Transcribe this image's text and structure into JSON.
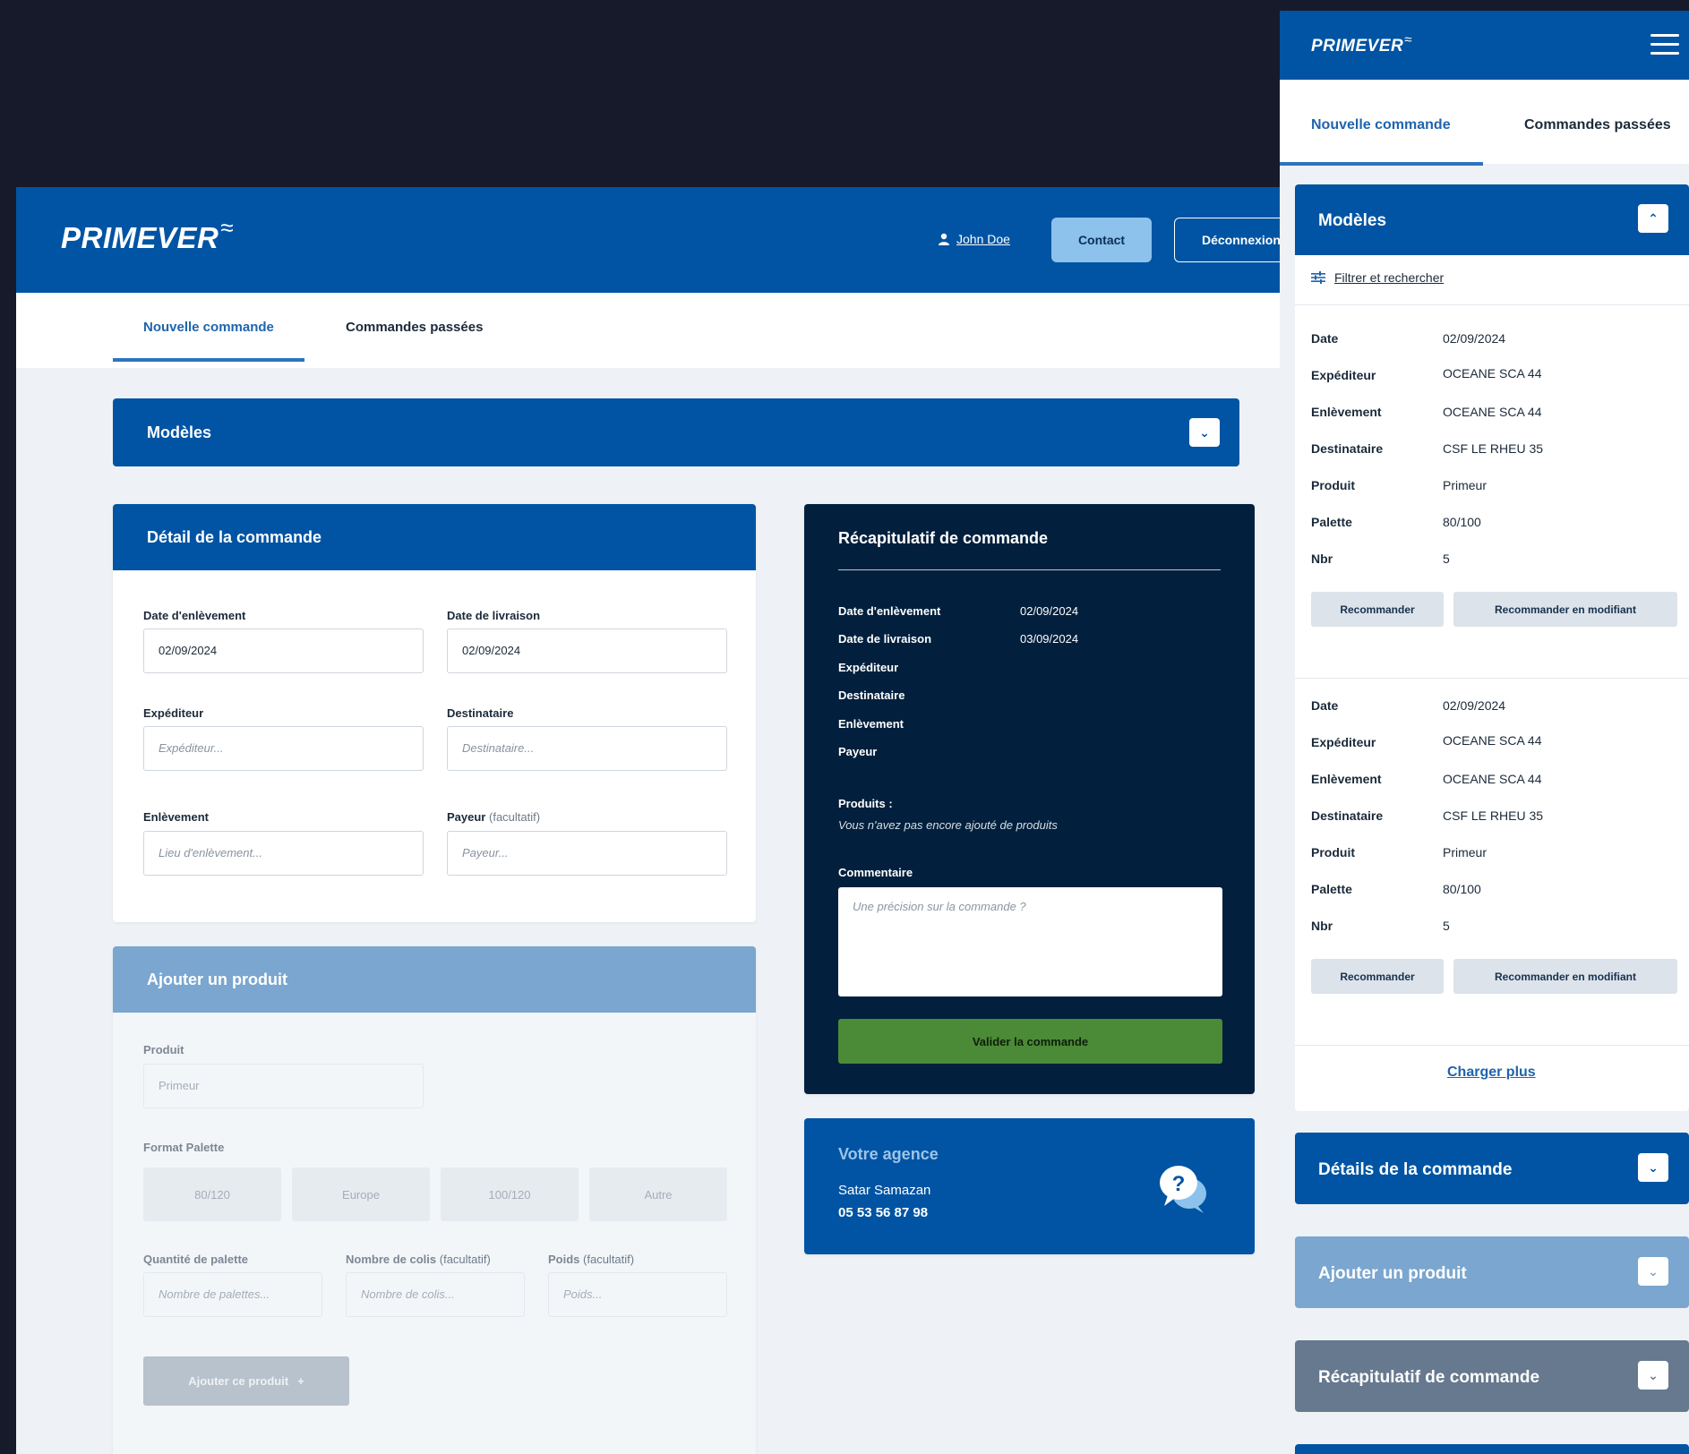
{
  "colors": {
    "brand": "#0054a3",
    "recap_bg": "#02203d",
    "validate": "#4b8a37",
    "light_blue": "#7aa6cf"
  },
  "brand": {
    "name": "PRIMEVER",
    "mark": "≈"
  },
  "header": {
    "user": "John Doe",
    "contact_label": "Contact",
    "logout_label": "Déconnexion"
  },
  "tabs": {
    "new_order": "Nouvelle commande",
    "past_orders": "Commandes passées"
  },
  "models_bar": {
    "title": "Modèles"
  },
  "detail": {
    "title": "Détail de la commande",
    "pickup_date_label": "Date d'enlèvement",
    "pickup_date_value": "02/09/2024",
    "delivery_date_label": "Date de livraison",
    "delivery_date_value": "02/09/2024",
    "sender_label": "Expéditeur",
    "sender_placeholder": "Expéditeur...",
    "recipient_label": "Destinataire",
    "recipient_placeholder": "Destinataire...",
    "pickup_label": "Enlèvement",
    "pickup_placeholder": "Lieu d'enlèvement...",
    "payer_label": "Payeur",
    "payer_optional": "(facultatif)",
    "payer_placeholder": "Payeur..."
  },
  "add_product": {
    "title": "Ajouter un produit",
    "product_label": "Produit",
    "product_value": "Primeur",
    "pallet_format_label": "Format Palette",
    "pallet_formats": [
      "80/120",
      "Europe",
      "100/120",
      "Autre"
    ],
    "pallet_qty_label": "Quantité de palette",
    "pallet_qty_placeholder": "Nombre de palettes...",
    "parcels_label": "Nombre de colis",
    "parcels_optional": "(facultatif)",
    "parcels_placeholder": "Nombre de colis...",
    "weight_label": "Poids",
    "weight_optional": "(facultatif)",
    "weight_placeholder": "Poids...",
    "add_button": "Ajouter ce produit",
    "add_button_icon": "+"
  },
  "recap": {
    "title": "Récapitulatif de commande",
    "rows": [
      {
        "label": "Date d'enlèvement",
        "value": "02/09/2024"
      },
      {
        "label": "Date de livraison",
        "value": "03/09/2024"
      },
      {
        "label": "Expéditeur",
        "value": ""
      },
      {
        "label": "Destinataire",
        "value": ""
      },
      {
        "label": "Enlèvement",
        "value": ""
      },
      {
        "label": "Payeur",
        "value": ""
      }
    ],
    "products_label": "Produits :",
    "products_empty": "Vous n'avez pas encore ajouté de produits",
    "comment_label": "Commentaire",
    "comment_placeholder": "Une précision sur la commande ?",
    "validate_button": "Valider la commande"
  },
  "agency": {
    "title": "Votre agence",
    "contact_name": "Satar Samazan",
    "phone": "05 53 56 87 98",
    "help_icon": "?"
  },
  "mobile": {
    "models_title": "Modèles",
    "filter_label": "Filtrer et rechercher",
    "templates": [
      {
        "rows": [
          {
            "label": "Date",
            "value": "02/09/2024"
          },
          {
            "label": "Expéditeur",
            "value": "OCEANE SCA 44"
          },
          {
            "label": "Enlèvement",
            "value": "OCEANE SCA 44"
          },
          {
            "label": "Destinataire",
            "value": "CSF LE RHEU 35"
          },
          {
            "label": "Produit",
            "value": "Primeur"
          },
          {
            "label": "Palette",
            "value": "80/100"
          },
          {
            "label": "Nbr",
            "value": "5"
          }
        ],
        "reorder": "Recommander",
        "reorder_modify": "Recommander en modifiant"
      },
      {
        "rows": [
          {
            "label": "Date",
            "value": "02/09/2024"
          },
          {
            "label": "Expéditeur",
            "value": "OCEANE SCA 44"
          },
          {
            "label": "Enlèvement",
            "value": "OCEANE SCA 44"
          },
          {
            "label": "Destinataire",
            "value": "CSF LE RHEU 35"
          },
          {
            "label": "Produit",
            "value": "Primeur"
          },
          {
            "label": "Palette",
            "value": "80/100"
          },
          {
            "label": "Nbr",
            "value": "5"
          }
        ],
        "reorder": "Recommander",
        "reorder_modify": "Recommander en modifiant"
      }
    ],
    "load_more": "Charger plus",
    "details_title": "Détails de la commande",
    "add_product_title": "Ajouter un produit",
    "recap_title": "Récapitulatif de commande"
  }
}
